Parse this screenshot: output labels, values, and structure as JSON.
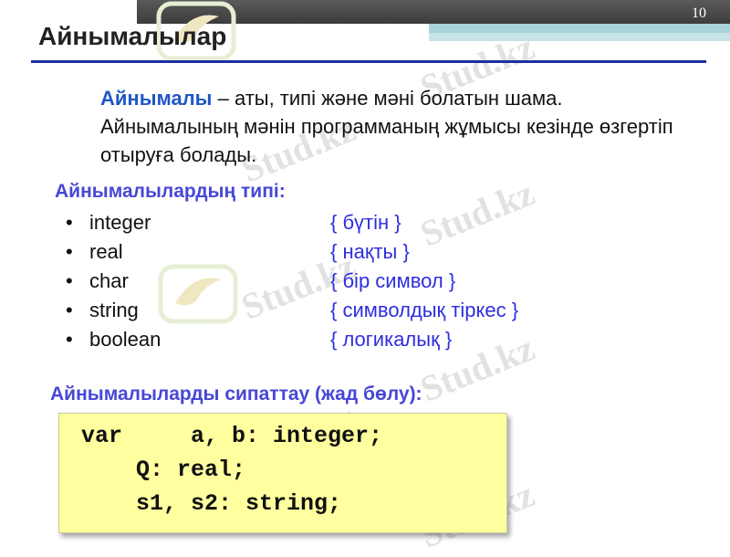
{
  "slide": {
    "number": "10",
    "title": "Айнымалылар"
  },
  "intro": {
    "keyword": "Айнымалы",
    "text": " – аты, типі және мәні болатын шама. Айнымалының мәнін программаның жұмысы кезінде өзгертіп отыруға болады."
  },
  "types": {
    "heading": "Айнымалылардың типі:",
    "items": [
      {
        "type": "integer",
        "desc": "{ бүтін }"
      },
      {
        "type": "real",
        "desc": "{ нақты }"
      },
      {
        "type": "char",
        "desc": "{ бір символ }"
      },
      {
        "type": "string",
        "desc": "{ символдық тіркес }"
      },
      {
        "type": "boolean",
        "desc": "{ логикалық }"
      }
    ]
  },
  "declaration": {
    "heading": "Айнымалыларды сипаттау (жад бөлу):",
    "lines": [
      "var     a, b: integer;",
      "    Q: real;",
      "    s1, s2: string;"
    ]
  },
  "watermark": {
    "text": "Stud.kz"
  },
  "colors": {
    "accent_blue": "#1f56c8",
    "heading_purple": "#4747d6",
    "desc_blue": "#2e2ee0",
    "code_bg": "#ffff9f",
    "rule": "#1e2ea0"
  }
}
